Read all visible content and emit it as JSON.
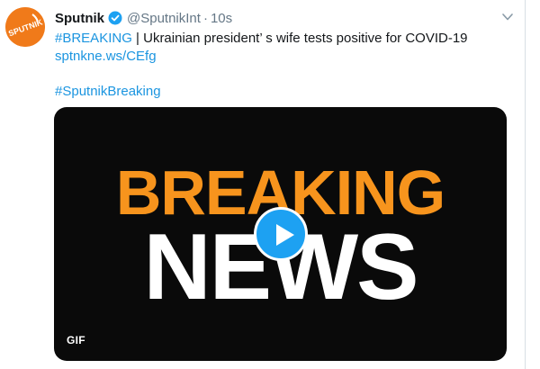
{
  "tweet": {
    "author_name": "Sputnik",
    "handle": "@SputnikInt",
    "separator": "·",
    "time": "10s",
    "hashtag_breaking": "#BREAKING",
    "body_text": " | Ukrainian president’ s wife tests positive for COVID-19",
    "link": "sptnkne.ws/CEfg",
    "hashtag_sputnik": "#SputnikBreaking",
    "avatar_text": "SPUTNIK"
  },
  "media": {
    "line1": "BREAKING",
    "line2": "NEWS",
    "badge": "GIF"
  },
  "icons": {
    "verified": "verified-badge-icon",
    "menu": "chevron-down-icon",
    "play": "play-icon"
  },
  "colors": {
    "link": "#1b95e0",
    "brand_orange": "#f07a1a",
    "breaking_orange": "#f7941d",
    "play_blue": "#1da1f2"
  }
}
